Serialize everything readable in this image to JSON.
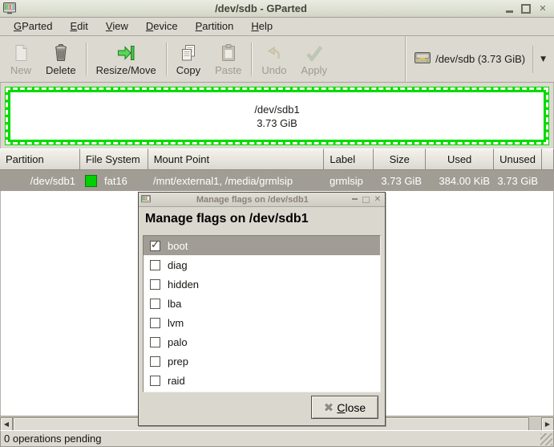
{
  "window": {
    "title": "/dev/sdb - GParted"
  },
  "menubar": {
    "items": [
      {
        "label": "GParted",
        "accel_index": 0
      },
      {
        "label": "Edit",
        "accel_index": 0
      },
      {
        "label": "View",
        "accel_index": 0
      },
      {
        "label": "Device",
        "accel_index": 0
      },
      {
        "label": "Partition",
        "accel_index": 0
      },
      {
        "label": "Help",
        "accel_index": 0
      }
    ]
  },
  "toolbar": {
    "groups": [
      [
        {
          "label": "New",
          "icon": "new-partition-icon",
          "enabled": false
        },
        {
          "label": "Delete",
          "icon": "delete-partition-icon",
          "enabled": true
        }
      ],
      [
        {
          "label": "Resize/Move",
          "icon": "resize-move-icon",
          "enabled": true
        }
      ],
      [
        {
          "label": "Copy",
          "icon": "copy-icon",
          "enabled": true
        },
        {
          "label": "Paste",
          "icon": "paste-icon",
          "enabled": false
        }
      ],
      [
        {
          "label": "Undo",
          "icon": "undo-icon",
          "enabled": false
        },
        {
          "label": "Apply",
          "icon": "apply-icon",
          "enabled": false
        }
      ]
    ],
    "device_selector": {
      "label": "/dev/sdb  (3.73 GiB)"
    }
  },
  "partition_view": {
    "partition": "/dev/sdb1",
    "size": "3.73 GiB"
  },
  "partition_table": {
    "columns": [
      "Partition",
      "File System",
      "Mount Point",
      "Label",
      "Size",
      "Used",
      "Unused"
    ],
    "rows": [
      {
        "partition": "/dev/sdb1",
        "filesystem": "fat16",
        "filesystem_color": "#00cf00",
        "mount_point": "/mnt/external1, /media/grmlsip",
        "label": "grmlsip",
        "size": "3.73 GiB",
        "used": "384.00 KiB",
        "unused": "3.73 GiB"
      }
    ]
  },
  "dialog": {
    "title": "Manage flags on /dev/sdb1",
    "heading": "Manage flags on /dev/sdb1",
    "flags": [
      {
        "label": "boot",
        "checked": true,
        "selected": true
      },
      {
        "label": "diag",
        "checked": false,
        "selected": false
      },
      {
        "label": "hidden",
        "checked": false,
        "selected": false
      },
      {
        "label": "lba",
        "checked": false,
        "selected": false
      },
      {
        "label": "lvm",
        "checked": false,
        "selected": false
      },
      {
        "label": "palo",
        "checked": false,
        "selected": false
      },
      {
        "label": "prep",
        "checked": false,
        "selected": false
      },
      {
        "label": "raid",
        "checked": false,
        "selected": false
      }
    ],
    "close_button": {
      "label": "Close",
      "accel_index": 0
    }
  },
  "statusbar": {
    "text": "0 operations pending"
  },
  "icons": {
    "window_close": "✕",
    "dialog_close": "✕",
    "dropdown_arrow": "▼",
    "scroll_left": "◀",
    "scroll_right": "▶",
    "checkmark": "✓",
    "close_button_x": "✖"
  },
  "colors": {
    "selection_gray": "#a19d94",
    "partition_border_green": "#00dc00",
    "fat16_green": "#00cf00"
  }
}
